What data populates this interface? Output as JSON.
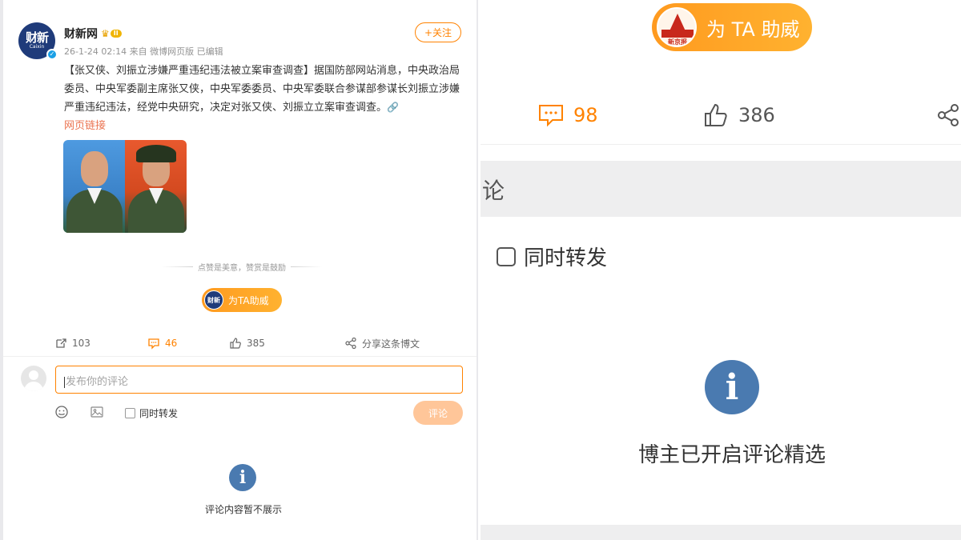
{
  "left": {
    "author": {
      "avatar_text": "财新",
      "avatar_sub": "Caixin",
      "name": "财新网",
      "level": "II",
      "meta": "26-1-24 02:14 来自 微博网页版 已编辑",
      "verified_icon": "verified-badge-icon"
    },
    "follow_label": "+关注",
    "post": {
      "text": "【张又侠、刘振立涉嫌严重违纪违法被立案审查调查】据国防部网站消息，中央政治局委员、中央军委副主席张又侠，中央军委委员、中央军委联合参谋部参谋长刘振立涉嫌严重违纪违法，经党中央研究，决定对张又侠、刘振立立案审查调查。",
      "link_label": "网页链接"
    },
    "encourage_text": "点赞是美意，赞赏是鼓励",
    "reward": {
      "logo_text": "财新",
      "label": "为TA助威"
    },
    "actions": {
      "repost_count": "103",
      "comment_count": "46",
      "like_count": "385",
      "share_label": "分享这条博文"
    },
    "comment_box": {
      "placeholder": "发布你的评论",
      "forward_label": "同时转发",
      "submit_label": "评论"
    },
    "notice": "评论内容暂不展示",
    "colors": {
      "accent": "#ff8200",
      "info_blue": "#4a7ab0",
      "brand_navy": "#1f3b7a"
    }
  },
  "right": {
    "reward": {
      "logo_text": "新京报",
      "label": "为 TA 助威"
    },
    "actions": {
      "comment_count": "98",
      "like_count": "386"
    },
    "tab_label": "论",
    "forward_label": "同时转发",
    "notice": "博主已开启评论精选"
  }
}
